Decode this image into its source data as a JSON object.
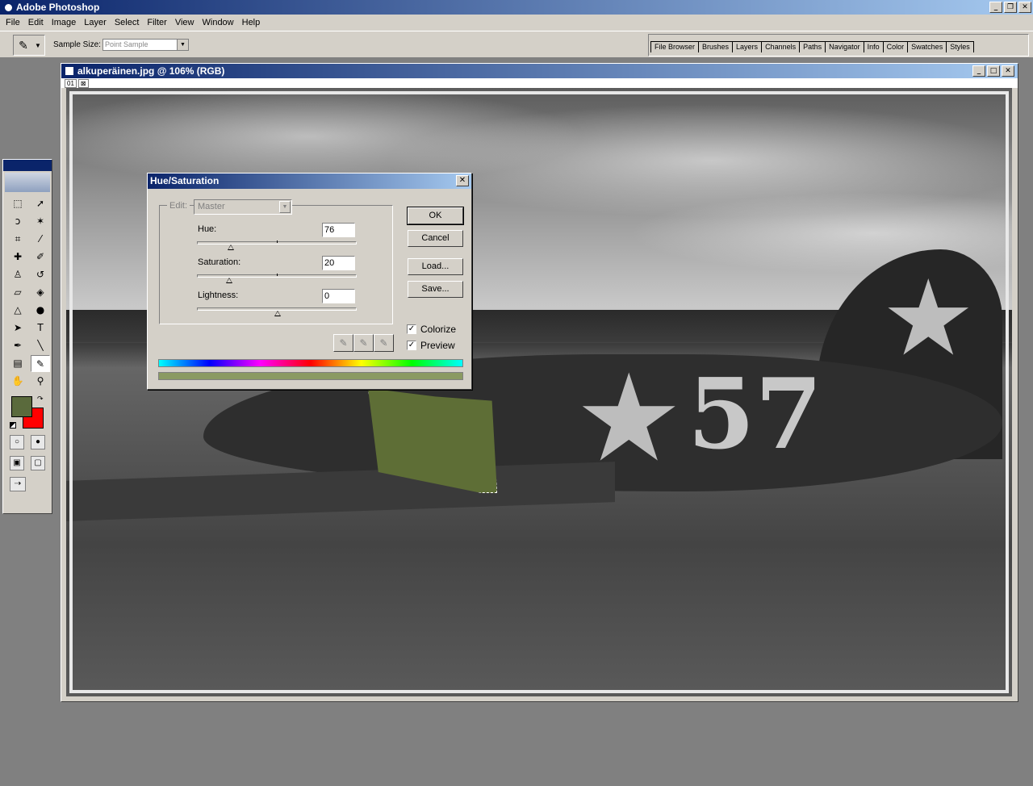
{
  "app": {
    "title": "Adobe Photoshop"
  },
  "menu": [
    "File",
    "Edit",
    "Image",
    "Layer",
    "Select",
    "Filter",
    "View",
    "Window",
    "Help"
  ],
  "options_bar": {
    "sample_size_label": "Sample Size:",
    "sample_size_value": "Point Sample"
  },
  "palette_well": [
    "File Browser",
    "Brushes",
    "Layers",
    "Channels",
    "Paths",
    "Navigator",
    "Info",
    "Color",
    "Swatches",
    "Styles"
  ],
  "toolbox": {
    "foreground_color": "#5a6a3c",
    "background_color": "#ff0000"
  },
  "document": {
    "title": "alkuperäinen.jpg @ 106% (RGB)",
    "sub_tabs": [
      "01",
      "⊠"
    ],
    "plane_number": "57"
  },
  "dialog": {
    "title": "Hue/Saturation",
    "edit_label": "Edit:",
    "edit_value": "Master",
    "hue_label": "Hue:",
    "hue_value": "76",
    "saturation_label": "Saturation:",
    "saturation_value": "20",
    "lightness_label": "Lightness:",
    "lightness_value": "0",
    "buttons": {
      "ok": "OK",
      "cancel": "Cancel",
      "load": "Load...",
      "save": "Save..."
    },
    "colorize_label": "Colorize",
    "preview_label": "Preview",
    "colorize_checked": true,
    "preview_checked": true,
    "result_color": "#8a9a62"
  }
}
